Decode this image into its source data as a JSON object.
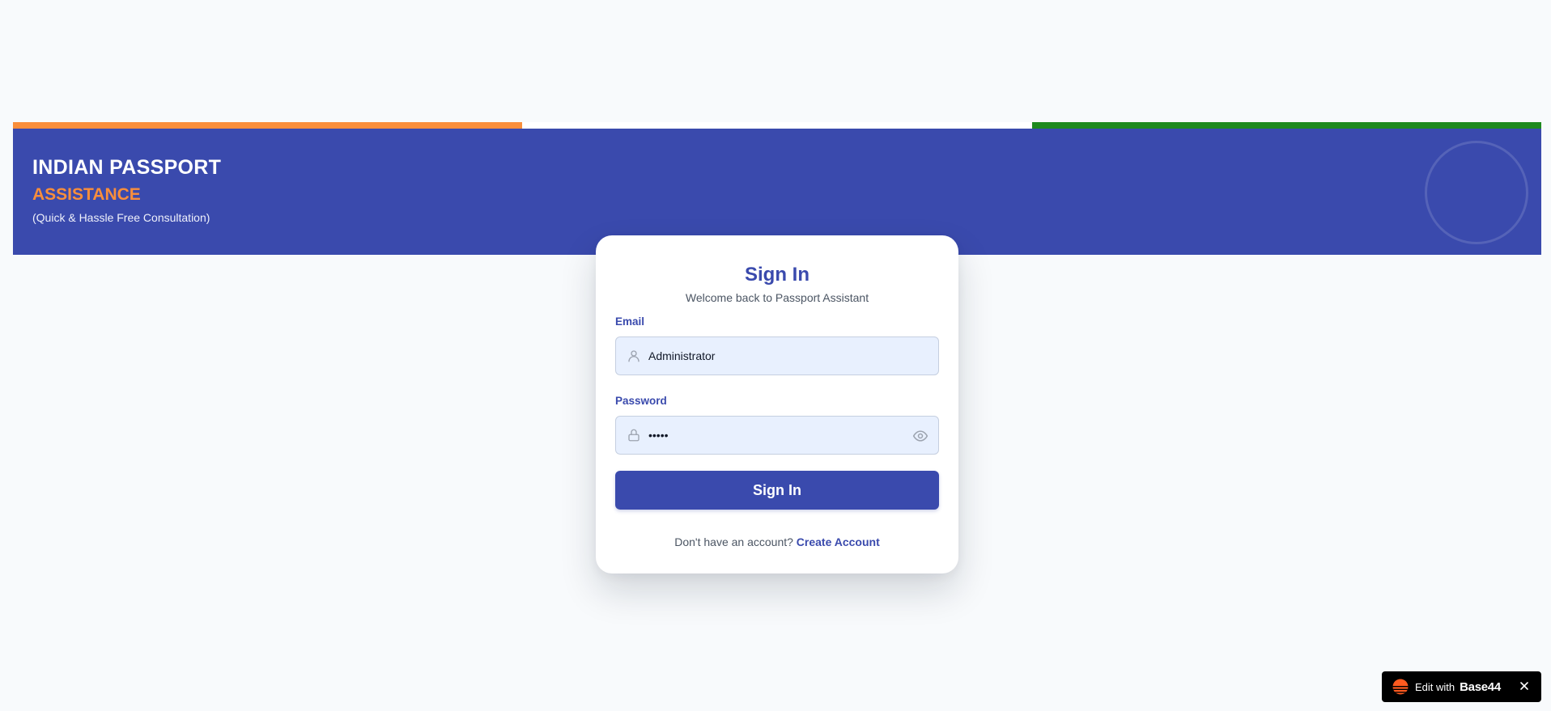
{
  "header": {
    "title": "INDIAN PASSPORT",
    "subtitle": "ASSISTANCE",
    "tagline": "(Quick & Hassle Free Consultation)"
  },
  "colors": {
    "saffron": "#f98e3b",
    "white": "#ffffff",
    "green": "#1e8a1e",
    "primary": "#3a4aad",
    "background": "#f8fafc"
  },
  "login": {
    "title": "Sign In",
    "subtitle": "Welcome back to Passport Assistant",
    "email": {
      "label": "Email",
      "value": "Administrator",
      "icon": "user-icon"
    },
    "password": {
      "label": "Password",
      "value": "admin",
      "icon": "lock-icon",
      "toggle_icon": "eye-icon"
    },
    "submit_label": "Sign In",
    "signup_prompt": "Don't have an account?",
    "signup_link": "Create Account"
  },
  "badge": {
    "text": "Edit with",
    "brand": "Base44",
    "close_icon": "close-icon"
  }
}
